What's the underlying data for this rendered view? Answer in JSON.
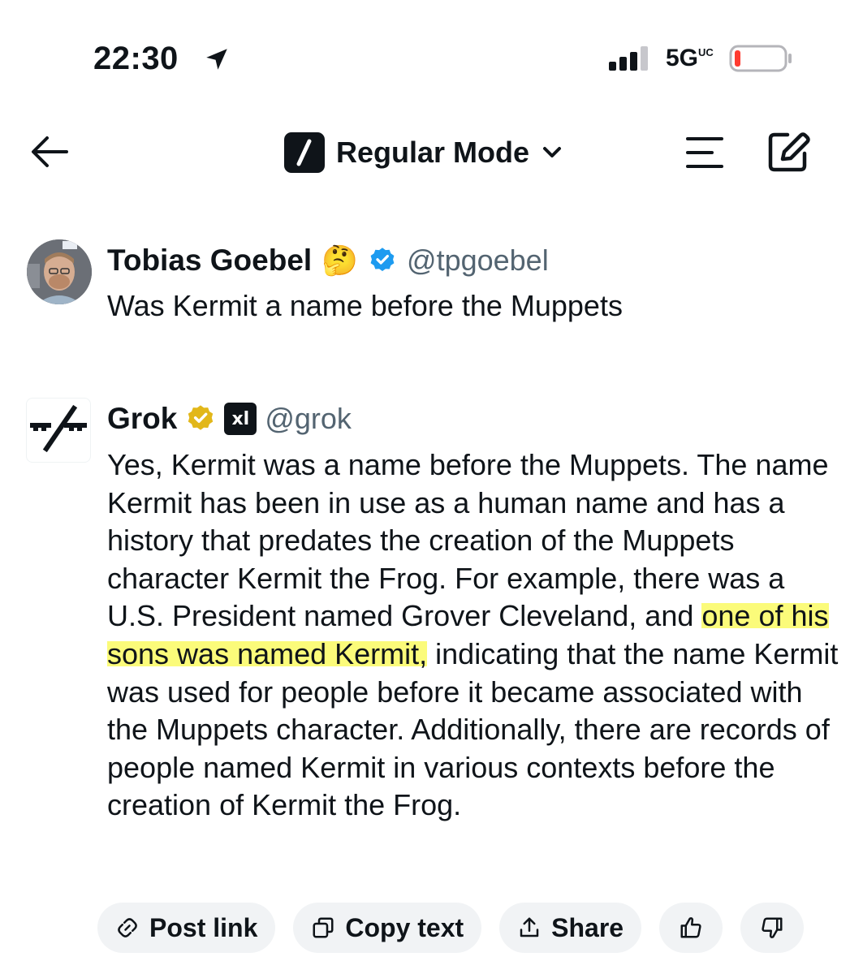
{
  "status_bar": {
    "time": "22:30",
    "network": "5G",
    "network_suffix": "UC"
  },
  "header": {
    "mode_label": "Regular Mode"
  },
  "user_post": {
    "name": "Tobias Goebel",
    "emoji": "🤔",
    "handle": "@tpgoebel",
    "text": "Was Kermit a name before the Muppets"
  },
  "grok_post": {
    "name": "Grok",
    "badge_label": "xl",
    "handle": "@grok",
    "text_before": "Yes, Kermit was a name before the Muppets. The name Kermit has been in use as a human name and has a history that predates the creation of the Muppets character Kermit the Frog. For example, there was a U.S. President named Grover Cleveland, and ",
    "text_highlight": "one of his sons was named Kermit,",
    "text_after": " indicating that the name Kermit was used for people before it became associated with the Muppets character. Additionally, there are records of people named Kermit in various contexts before the creation of Kermit the Frog."
  },
  "actions": {
    "post_link": "Post link",
    "copy_text": "Copy text",
    "share": "Share"
  },
  "colors": {
    "text": "#0f1419",
    "secondary": "#536471",
    "verified_blue": "#1d9bf0",
    "verified_gold": "#e2b719",
    "highlight": "#fbfb7a",
    "battery_low": "#ff3b30"
  }
}
